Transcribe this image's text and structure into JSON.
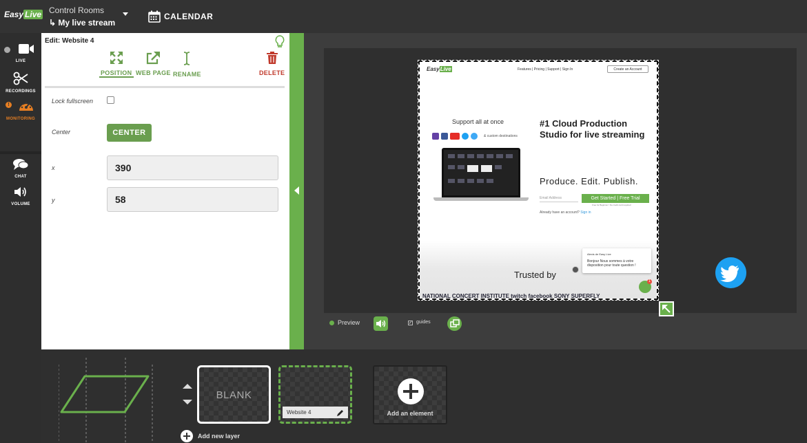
{
  "app": {
    "logo_a": "Easy",
    "logo_b": "Live"
  },
  "header": {
    "control_rooms_label": "Control Rooms",
    "stream_name": "My live stream",
    "calendar_label": "CALENDAR"
  },
  "nav": {
    "live": "LIVE",
    "recordings": "RECORDINGS",
    "monitoring": "MONITORING",
    "chat": "CHAT",
    "volume": "VOLUME"
  },
  "edit": {
    "title": "Edit: Website 4",
    "tabs": {
      "position": "POSITION",
      "web_page": "WEB PAGE",
      "rename": "RENAME",
      "delete": "DELETE"
    },
    "lock_fullscreen_label": "Lock fullscreen",
    "center_label": "Center",
    "center_button": "CENTER",
    "x_label": "x",
    "x_value": "390",
    "y_label": "y",
    "y_value": "58"
  },
  "website": {
    "logo_a": "Easy",
    "logo_b": "Live",
    "nav": "Features  |  Pricing  |  Support  |  Sign In",
    "create_account": "Create an Account",
    "support": "Support all at once",
    "custom_dest": "& custom destinations",
    "headline": "#1 Cloud Production Studio for live streaming",
    "tagline": "Produce. Edit. Publish.",
    "email_placeholder": "Email Address",
    "cta": "Get Started | Free Trial",
    "free_note": "Free for Beginner / No credit card required",
    "already": "Already have an account? ",
    "sign_in": "Sign in",
    "trusted": "Trusted by",
    "brands": "NATIONAL CONCERT INSTITUTE   twitch   facebook   SONY   SUPERFLY",
    "chat_name": "Alexis de Easy Live",
    "chat_message": "Bonjour Nous sommes à votre disposition pour toute question !",
    "chat_badge": "1"
  },
  "preview": {
    "label": "Preview",
    "guides": "guides"
  },
  "layers": {
    "blank": "BLANK",
    "website": "Website 4",
    "add_element": "Add an element",
    "add_layer": "Add new layer"
  },
  "colors": {
    "accent": "#6ab04c",
    "delete": "#c0392b",
    "twitter": "#1da1f2"
  }
}
